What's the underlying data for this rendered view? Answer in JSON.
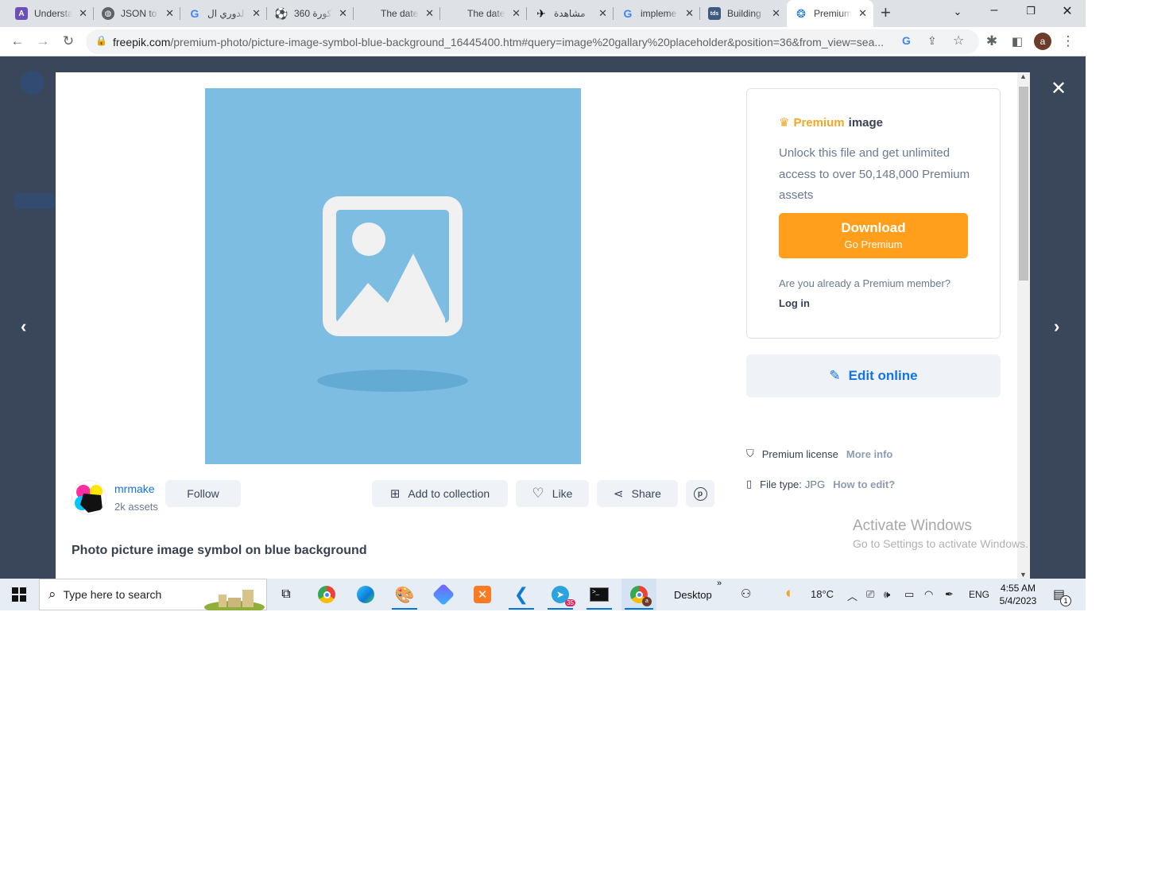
{
  "browser": {
    "tabs": [
      {
        "title": "Understa",
        "favicon": "purple-logo-icon",
        "color": "#6b4fbb"
      },
      {
        "title": "JSON to",
        "favicon": "globe-icon",
        "color": "#5f6368"
      },
      {
        "title": "الدوري ال",
        "favicon": "google-g-icon",
        "color": "#4285f4"
      },
      {
        "title": "360 كورة",
        "favicon": "ball-logo-icon",
        "color": "#000000"
      },
      {
        "title": "The date",
        "favicon": "blank-icon",
        "color": "#dee1e6"
      },
      {
        "title": "The date",
        "favicon": "blank-icon",
        "color": "#dee1e6"
      },
      {
        "title": "مشاهدة",
        "favicon": "player-icon",
        "color": "#000000"
      },
      {
        "title": "impleme",
        "favicon": "google-g-icon",
        "color": "#4285f4"
      },
      {
        "title": "Building",
        "favicon": "tds-icon",
        "color": "#3d5a80"
      },
      {
        "title": "Premium",
        "favicon": "freepik-icon",
        "color": "#1273eb"
      }
    ],
    "url_domain": "freepik.com",
    "url_path": "/premium-photo/picture-image-symbol-blue-background_16445400.htm#query=image%20gallary%20placeholder&position=36&from_view=sea...",
    "profile_initial": "a"
  },
  "modal": {
    "premium_label": "Premium",
    "premium_suffix": "image",
    "unlock_text": "Unlock this file and get unlimited access to over 50,148,000 Premium assets",
    "download_label": "Download",
    "download_sub": "Go Premium",
    "already_member": "Are you already a Premium member?",
    "login": "Log in",
    "edit_online": "Edit online",
    "license_label": "Premium license",
    "license_more": "More info",
    "filetype_label": "File type:",
    "filetype_value": "JPG",
    "filetype_link": "How to edit?",
    "author_name": "mrmake",
    "author_assets": "2k assets",
    "follow": "Follow",
    "add_collection": "Add to collection",
    "like": "Like",
    "share": "Share",
    "title": "Photo picture image symbol on blue background"
  },
  "watermark": {
    "line1": "Activate Windows",
    "line2": "Go to Settings to activate Windows."
  },
  "taskbar": {
    "search_placeholder": "Type here to search",
    "desktop_label": "Desktop",
    "desktop_chevron": "»",
    "temperature": "18°C",
    "language": "ENG",
    "time": "4:55 AM",
    "date": "5/4/2023",
    "telegram_badge": "35",
    "notification_count": "1"
  },
  "colors": {
    "accent_orange": "#ff9f1c",
    "premium_gold": "#f5a623",
    "link_blue": "#1273eb",
    "modal_backdrop": "#3a4659",
    "photo_bg": "#7dbde2"
  }
}
